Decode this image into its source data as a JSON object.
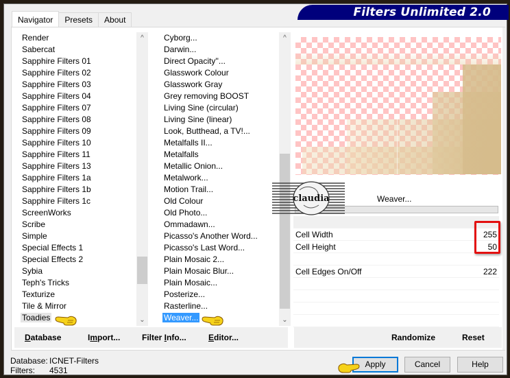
{
  "window": {
    "brand_title": "Filters Unlimited 2.0"
  },
  "tabs": [
    {
      "label": "Navigator",
      "active": true
    },
    {
      "label": "Presets",
      "active": false
    },
    {
      "label": "About",
      "active": false
    }
  ],
  "categories": {
    "items": [
      "Render",
      "Sabercat",
      "Sapphire Filters 01",
      "Sapphire Filters 02",
      "Sapphire Filters 03",
      "Sapphire Filters 04",
      "Sapphire Filters 07",
      "Sapphire Filters 08",
      "Sapphire Filters 09",
      "Sapphire Filters 10",
      "Sapphire Filters 11",
      "Sapphire Filters 13",
      "Sapphire Filters 1a",
      "Sapphire Filters 1b",
      "Sapphire Filters 1c",
      "ScreenWorks",
      "Scribe",
      "Simple",
      "Special Effects 1",
      "Special Effects 2",
      "Sybia",
      "Teph's Tricks",
      "Texturize",
      "Tile & Mirror",
      "Toadies"
    ],
    "selected": "Toadies"
  },
  "filters": {
    "items": [
      "Cyborg...",
      "Darwin...",
      "Direct Opacity''...",
      "Glasswork Colour",
      "Glasswork Gray",
      "Grey removing BOOST",
      "Living Sine (circular)",
      "Living Sine (linear)",
      "Look, Butthead, a TV!...",
      "Metalfalls II...",
      "Metalfalls",
      "Metallic Onion...",
      "Metalwork...",
      "Motion Trail...",
      "Old Colour",
      "Old Photo...",
      "Ommadawn...",
      "Picasso's Another Word...",
      "Picasso's Last Word...",
      "Plain Mosaic 2...",
      "Plain Mosaic Blur...",
      "Plain Mosaic...",
      "Posterize...",
      "Rasterline...",
      "Weaver..."
    ],
    "selected": "Weaver..."
  },
  "left_buttons": {
    "database": {
      "pre": "",
      "u": "D",
      "post": "atabase"
    },
    "import": {
      "pre": "I",
      "u": "m",
      "post": "port..."
    },
    "filter_info": {
      "pre": "Filter ",
      "u": "I",
      "post": "nfo..."
    },
    "editor": {
      "pre": "",
      "u": "E",
      "post": "ditor..."
    }
  },
  "right_buttons": {
    "randomize": "Randomize",
    "reset": "Reset"
  },
  "preview": {
    "filter_name": "Weaver...",
    "watermark_text": "claudia"
  },
  "parameters": [
    {
      "label": "Cell Width",
      "value": "255"
    },
    {
      "label": "Cell Height",
      "value": "50"
    },
    {
      "label": "",
      "value": ""
    },
    {
      "label": "Cell Edges On/Off",
      "value": "222"
    },
    {
      "label": "",
      "value": ""
    },
    {
      "label": "",
      "value": ""
    },
    {
      "label": "",
      "value": ""
    },
    {
      "label": "",
      "value": ""
    }
  ],
  "status": {
    "database_label": "Database:",
    "database_value": "ICNET-Filters",
    "filters_label": "Filters:",
    "filters_value": "4531"
  },
  "dialog_buttons": {
    "apply": "Apply",
    "cancel": "Cancel",
    "help": "Help"
  },
  "colors": {
    "brand_bg": "#00007c",
    "selection": "#3399ff",
    "highlight_box": "#e31111",
    "default_button_border": "#0078d7"
  }
}
